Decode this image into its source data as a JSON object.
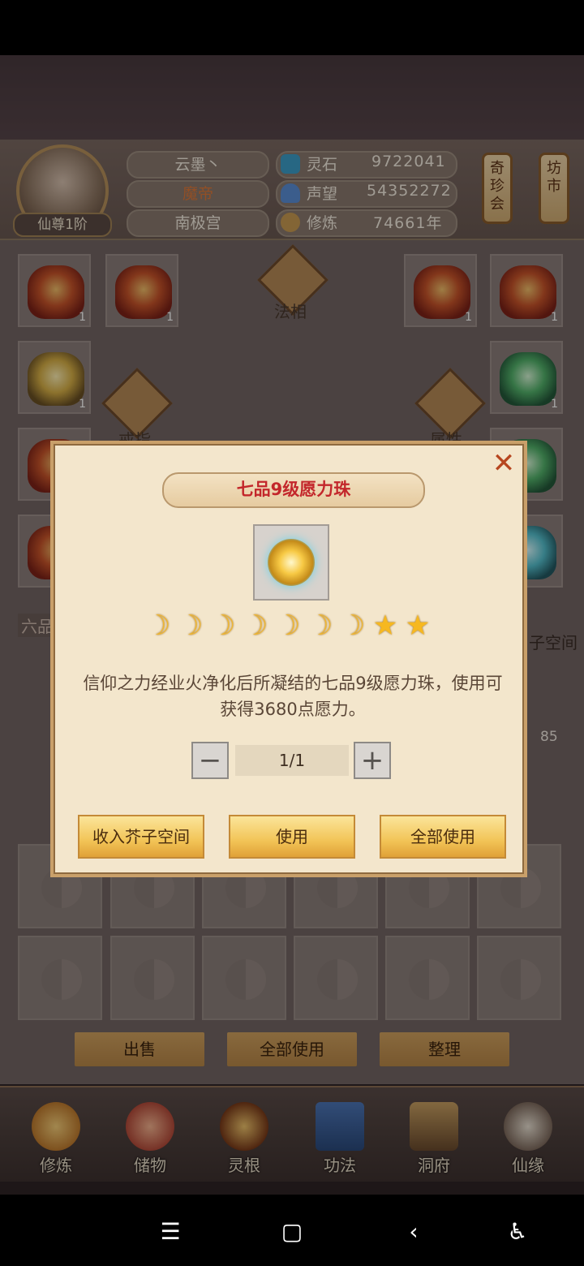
{
  "player": {
    "name": "云墨丶",
    "title": "魔帝",
    "sect": "南极宫",
    "rank": "仙尊1阶"
  },
  "stats": {
    "lingshi_label": "灵石",
    "lingshi_value": "9722041",
    "shengwang_label": "声望",
    "shengwang_value": "54352272",
    "xiulian_label": "修炼",
    "xiulian_value": "74661年"
  },
  "side_tags": {
    "left": "奇珍会",
    "right": "坊市"
  },
  "equipment": {
    "faxiang_label": "法相",
    "ring_label": "戒指",
    "attr_label": "属性",
    "tier_label": "六品",
    "space_label": "子空间",
    "count_label": "1",
    "stack_count": "85"
  },
  "bottom_actions": {
    "sell": "出售",
    "use_all": "全部使用",
    "sort": "整理"
  },
  "nav": [
    {
      "label": "修炼"
    },
    {
      "label": "储物"
    },
    {
      "label": "灵根"
    },
    {
      "label": "功法"
    },
    {
      "label": "洞府"
    },
    {
      "label": "仙缘"
    }
  ],
  "modal": {
    "title": "七品9级愿力珠",
    "description": "信仰之力经业火净化后所凝结的七品9级愿力珠，使用可获得3680点愿力。",
    "quantity": "1/1",
    "moons": 7,
    "stars": 2,
    "btn_store": "收入芥子空间",
    "btn_use": "使用",
    "btn_use_all": "全部使用",
    "close": "✕"
  }
}
